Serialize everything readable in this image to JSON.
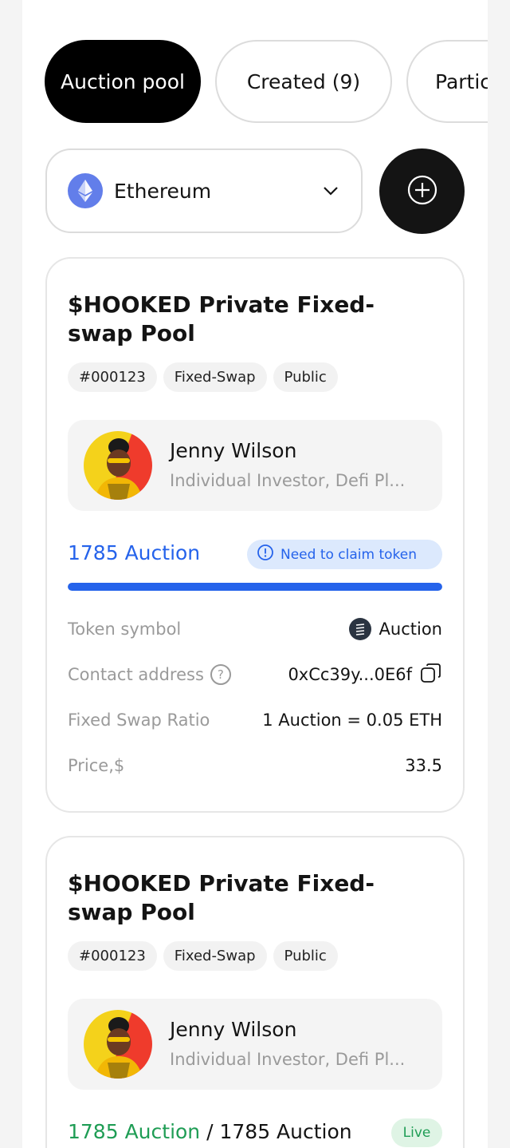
{
  "tabs": [
    {
      "label": "Auction pool",
      "active": true
    },
    {
      "label": "Created (9)",
      "active": false
    },
    {
      "label": "Partic",
      "active": false
    }
  ],
  "chain_select": {
    "label": "Ethereum",
    "icon": "ethereum-icon"
  },
  "add_button": {
    "icon": "plus-circle-icon"
  },
  "cards": [
    {
      "title": "$HOOKED Private Fixed-swap Pool",
      "tags": [
        "#000123",
        "Fixed-Swap",
        "Public"
      ],
      "user": {
        "name": "Jenny Wilson",
        "role": "Individual Investor, Defi Pl..."
      },
      "auction_count": "1785 Auction",
      "badge": "Need to claim token",
      "progress": 1.0,
      "rows": {
        "token_symbol": {
          "label": "Token symbol",
          "value": "Auction"
        },
        "contract_address": {
          "label": "Contact address",
          "value": "0xCc39y...0E6f"
        },
        "swap_ratio": {
          "label": "Fixed Swap Ratio",
          "value": "1 Auction = 0.05 ETH"
        },
        "price": {
          "label": "Price,$",
          "value": "33.5"
        }
      }
    },
    {
      "title": "$HOOKED Private Fixed-swap Pool",
      "tags": [
        "#000123",
        "Fixed-Swap",
        "Public"
      ],
      "user": {
        "name": "Jenny Wilson",
        "role": "Individual Investor, Defi Pl..."
      },
      "sold": "1785 Auction",
      "separator": " / ",
      "total": "1785 Auction",
      "badge": "Live"
    }
  ],
  "colors": {
    "accent_blue": "#2563eb",
    "live_green": "#1f9d55",
    "dark": "#141414"
  }
}
